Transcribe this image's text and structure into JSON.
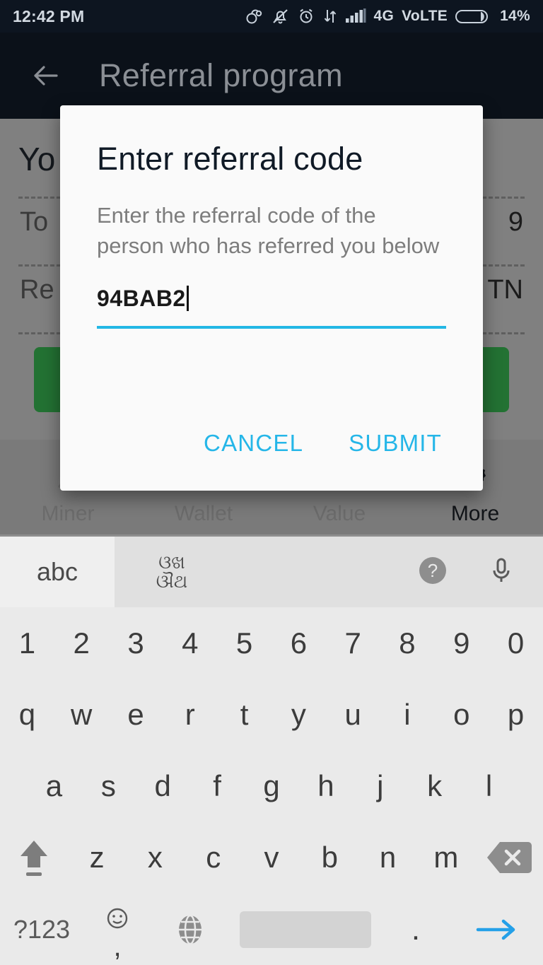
{
  "status_bar": {
    "time": "12:42 PM",
    "network": "4G",
    "volte": "VoLTE",
    "battery": "14%",
    "icons": [
      "headset-icon",
      "bell-muted-icon",
      "alarm-clock-icon",
      "data-transfer-icon",
      "signal-bars-icon",
      "battery-icon"
    ]
  },
  "app_bar": {
    "title": "Referral program",
    "back_icon": "back-arrow-icon"
  },
  "page": {
    "heading": "Yo",
    "rows": [
      {
        "label": "To",
        "value": "9"
      },
      {
        "label": "Re",
        "value": "TN"
      }
    ],
    "button_color": "#237233"
  },
  "bottom_nav": {
    "items": [
      {
        "label": "Miner",
        "icon": "pickaxe-icon",
        "active": false
      },
      {
        "label": "Wallet",
        "icon": "wallet-icon",
        "active": false
      },
      {
        "label": "Value",
        "icon": "chart-icon",
        "active": false
      },
      {
        "label": "More",
        "icon": "gear-icon",
        "active": true
      }
    ]
  },
  "dialog": {
    "title": "Enter referral code",
    "message": "Enter the referral code of the person who has referred you below",
    "input_value": "94BAB2",
    "cancel_label": "CANCEL",
    "submit_label": "SUBMIT",
    "accent_color": "#25b6e8"
  },
  "keyboard": {
    "toolbar": {
      "abc_tab": "abc",
      "script_tab_line1": "ଓଖ",
      "script_tab_line2": "ଔଥ",
      "help_icon": "help-circle-icon",
      "mic_icon": "microphone-icon"
    },
    "rows": {
      "numbers": [
        "1",
        "2",
        "3",
        "4",
        "5",
        "6",
        "7",
        "8",
        "9",
        "0"
      ],
      "letters1": [
        "q",
        "w",
        "e",
        "r",
        "t",
        "y",
        "u",
        "i",
        "o",
        "p"
      ],
      "letters2": [
        "a",
        "s",
        "d",
        "f",
        "g",
        "h",
        "j",
        "k",
        "l"
      ],
      "letters3": [
        "z",
        "x",
        "c",
        "v",
        "b",
        "n",
        "m"
      ]
    },
    "bottom_row": {
      "symbols_label": "?123",
      "comma_label": ",",
      "emoji_icon": "emoji-smiley-icon",
      "globe_icon": "globe-icon",
      "space_label": "",
      "period_label": ".",
      "enter_icon": "arrow-right-icon"
    },
    "shift_icon": "shift-arrow-icon",
    "backspace_icon": "backspace-icon"
  }
}
